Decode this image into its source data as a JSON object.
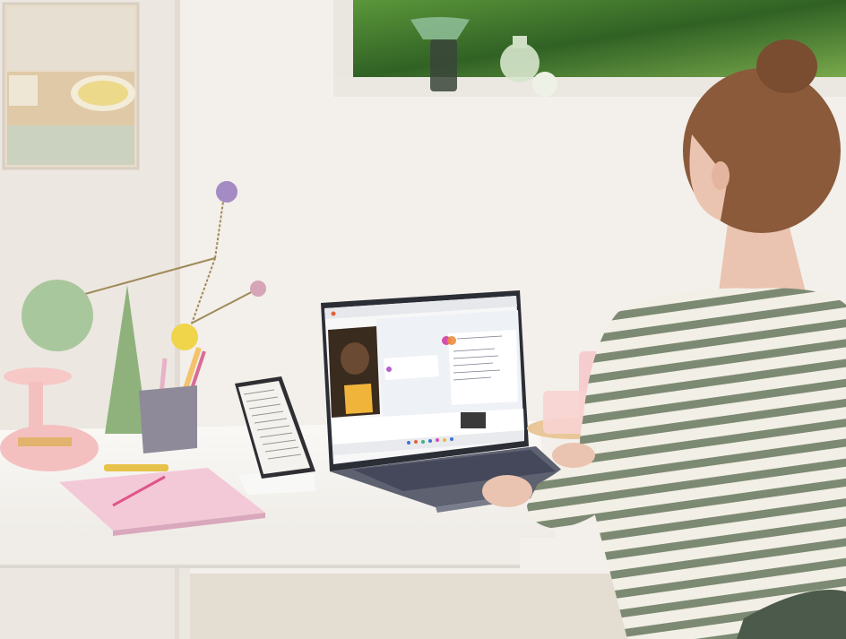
{
  "scene": {
    "palette": {
      "wall": "#f3efea",
      "wall_shadow": "#e6e0d9",
      "desk": "#f7f6f3",
      "desk_edge": "#e9e6e1",
      "floor": "#e4ddd2",
      "window_green": "#3f7a2a",
      "mobile_green": "#a9c79c",
      "mobile_purple": "#a48bc4",
      "mobile_pink": "#d6a5b8",
      "mobile_yellow": "#f0d54a",
      "stripe": "#7d8a73",
      "sweater": "#f2efe6",
      "hair": "#8a5a3a",
      "skin": "#eac4b0",
      "laptop": "#5d6170",
      "notebook_pink": "#f3c9d8",
      "pencil_cup": "#8f8a9a",
      "tray": "#f4c0bf",
      "glass_pink": "#f6c9cc"
    },
    "laptop_screen": {
      "icons": [
        "browser-window-icon",
        "chat-panel-icon",
        "video-thumbnail-icon",
        "taskbar-icons"
      ]
    },
    "phone_screen": {
      "icons": [
        "document-text-icon"
      ]
    }
  }
}
